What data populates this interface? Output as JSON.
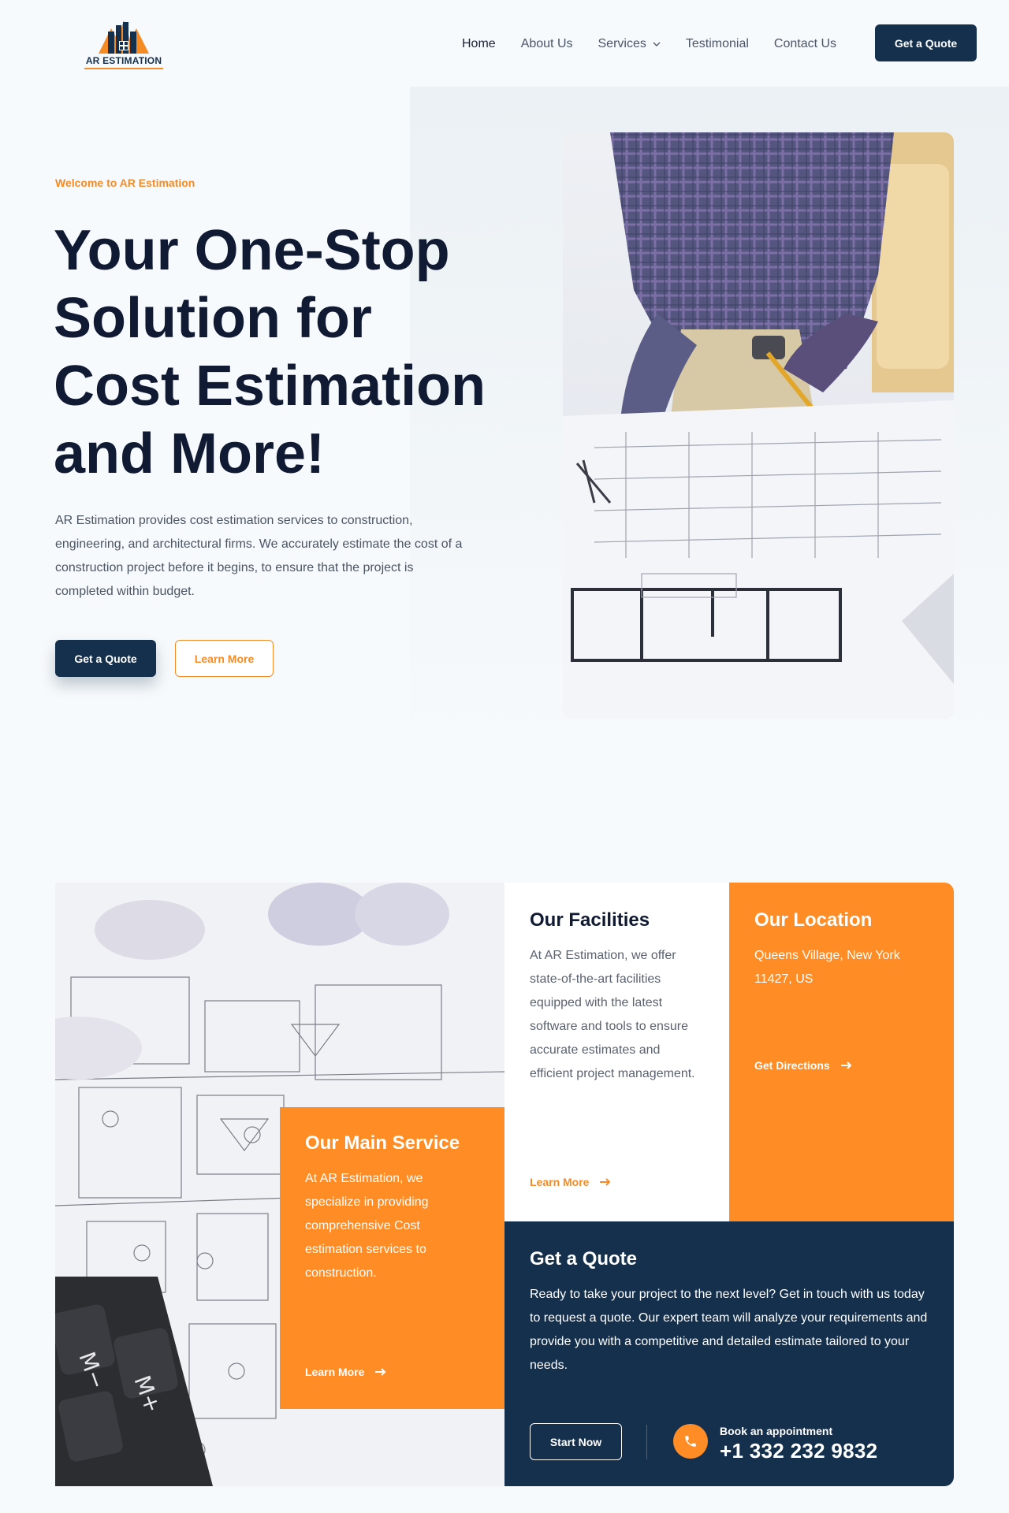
{
  "brand": {
    "logo_text": "AR ESTIMATION"
  },
  "nav": {
    "items": [
      "Home",
      "About Us",
      "Services",
      "Testimonial",
      "Contact Us"
    ],
    "cta": "Get a Quote"
  },
  "hero": {
    "eyebrow": "Welcome to AR Estimation",
    "title_lines": [
      "Your One-Stop",
      "Solution for",
      "Cost Estimation",
      "and More!"
    ],
    "text": "AR Estimation provides cost estimation services to construction, engineering, and architectural firms. We accurately estimate the cost of a construction project before it begins, to ensure that the project is completed within budget.",
    "primary_button": "Get a Quote",
    "secondary_button": "Learn More"
  },
  "cards": {
    "main": {
      "title": "Our Main Service",
      "text": "At AR Estimation, we specialize in providing comprehensive Cost estimation services to construction.",
      "link": "Learn More"
    },
    "facilities": {
      "title": "Our Facilities",
      "text": "At AR Estimation, we offer state-of-the-art facilities equipped with the latest software and tools to ensure accurate estimates and efficient project management.",
      "link": "Learn More"
    },
    "location": {
      "title": "Our Location",
      "text": "Queens Village, New York 11427, US",
      "link": "Get Directions"
    },
    "quote": {
      "title": "Get a Quote",
      "text": "Ready to take your project to the next level? Get in touch with us today to request a quote. Our expert team will analyze your requirements and provide you with a competitive and detailed estimate tailored to your needs.",
      "button": "Start Now",
      "appointment_label": "Book an appointment",
      "phone": "+1 332 232 9832"
    }
  },
  "colors": {
    "accent": "#ff8c25",
    "navy": "#15304d",
    "heading": "#111a33"
  }
}
